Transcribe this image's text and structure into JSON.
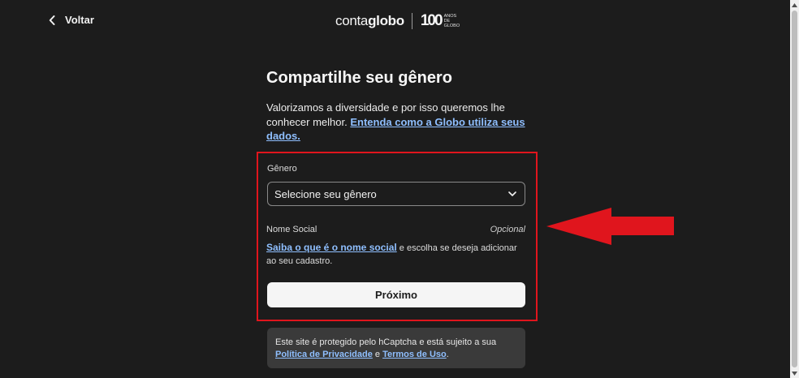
{
  "header": {
    "back_label": "Voltar",
    "brand_prefix": "conta",
    "brand_suffix": "globo",
    "anniversary_number": "100",
    "anniversary_caption_1": "ANOS",
    "anniversary_caption_2": "DE",
    "anniversary_caption_3": "GLOBO"
  },
  "main": {
    "title": "Compartilhe seu gênero",
    "intro_text": "Valorizamos a diversidade e por isso queremos lhe conhecer melhor. ",
    "intro_link": "Entenda como a Globo utiliza seus dados."
  },
  "form": {
    "gender_label": "Gênero",
    "gender_select_value": "Selecione seu gênero",
    "social_name_label": "Nome Social",
    "social_name_optional": "Opcional",
    "social_name_link": "Saiba o que é o nome social",
    "social_name_text": " e escolha se deseja adicionar ao seu cadastro.",
    "next_button": "Próximo"
  },
  "captcha": {
    "text_1": "Este site é protegido pelo hCaptcha e está sujeito a sua ",
    "privacy_link": "Política de Privacidade",
    "text_2": " e ",
    "terms_link": "Termos de Uso",
    "text_3": "."
  },
  "annotation": {
    "highlight_color": "#e0151d"
  },
  "icons": {
    "back": "chevron-left-icon",
    "select": "chevron-down-icon",
    "arrow": "red-arrow-left-icon"
  }
}
